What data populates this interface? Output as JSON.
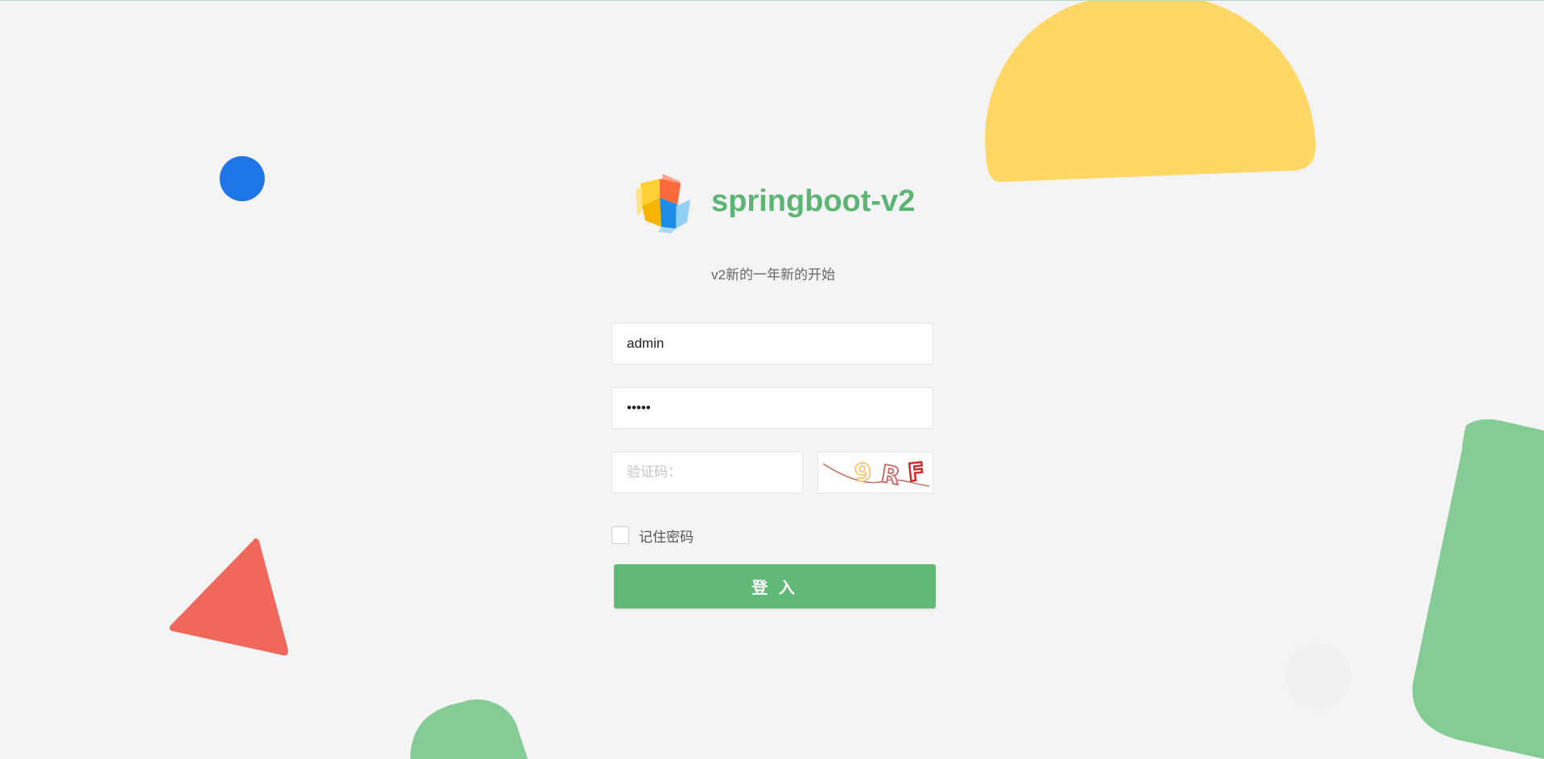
{
  "app": {
    "title": "springboot-v2",
    "subtitle": "v2新的一年新的开始"
  },
  "form": {
    "username_value": "admin",
    "password_value": "admin",
    "captcha_placeholder": "验证码：",
    "captcha_image_text": "9RF",
    "remember_label": "记住密码",
    "remember_checked": false,
    "login_button_label": "登 入"
  },
  "colors": {
    "background": "#f4f4f4",
    "brand_green": "#5eb475",
    "button_green": "#60b977",
    "yellow_shape": "#fed765",
    "blue_dot": "#1e75e8",
    "red_triangle": "#f0685c",
    "green_shape": "#84cb95"
  },
  "icons": {
    "logo": "cube-logo-icon",
    "checkbox": "checkbox-icon"
  }
}
